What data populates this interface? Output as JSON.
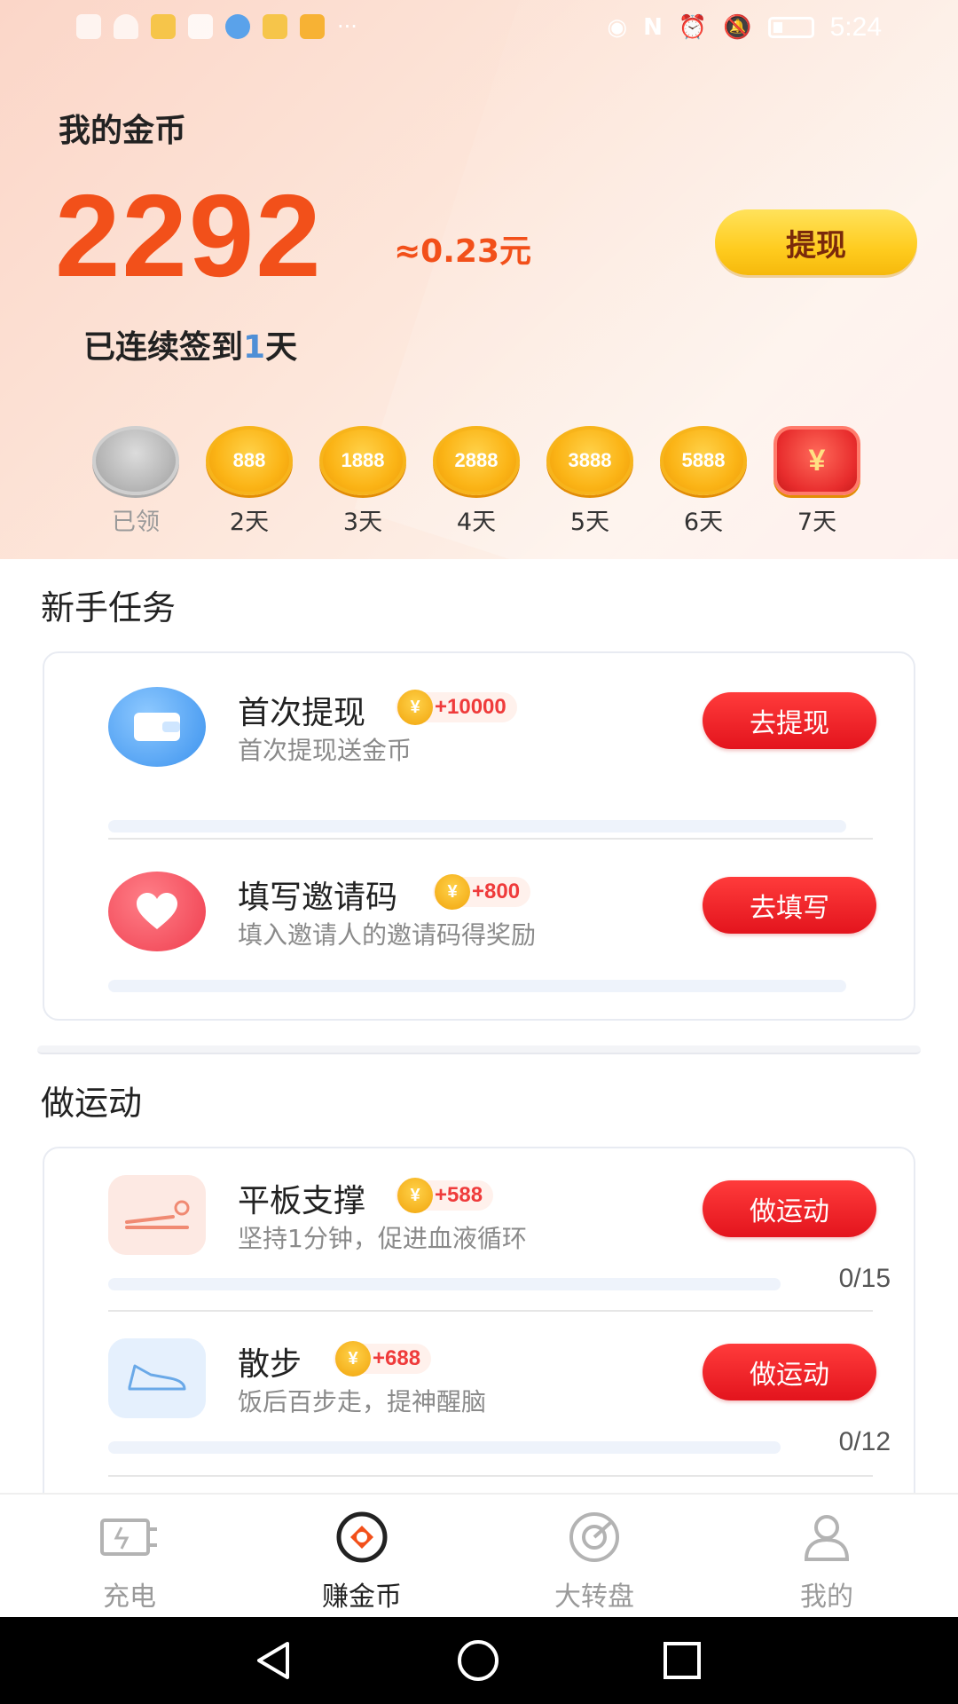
{
  "status_bar": {
    "time": "5:24"
  },
  "header": {
    "coins_title": "我的金币",
    "coins_value": "2292",
    "coins_approx": "≈0.23元",
    "withdraw_label": "提现",
    "checkin_prefix": "已连续签到",
    "checkin_days": "1",
    "checkin_suffix": "天"
  },
  "streak": [
    {
      "coin": "",
      "label": "已领",
      "claimed": true
    },
    {
      "coin": "888",
      "label": "2天"
    },
    {
      "coin": "1888",
      "label": "3天"
    },
    {
      "coin": "2888",
      "label": "4天"
    },
    {
      "coin": "3888",
      "label": "5天"
    },
    {
      "coin": "5888",
      "label": "6天"
    },
    {
      "coin": "¥",
      "label": "7天"
    }
  ],
  "newbie": {
    "title": "新手任务",
    "tasks": [
      {
        "name": "首次提现",
        "reward": "+10000",
        "desc": "首次提现送金币",
        "button": "去提现"
      },
      {
        "name": "填写邀请码",
        "reward": "+800",
        "desc": "填入邀请人的邀请码得奖励",
        "button": "去填写"
      }
    ]
  },
  "exercise": {
    "title": "做运动",
    "tasks": [
      {
        "name": "平板支撑",
        "reward": "+588",
        "desc": "坚持1分钟，促进血液循环",
        "button": "做运动",
        "progress": "0/15"
      },
      {
        "name": "散步",
        "reward": "+688",
        "desc": "饭后百步走，提神醒脑",
        "button": "做运动",
        "progress": "0/12"
      }
    ]
  },
  "coin_glyph": "¥",
  "bottom_nav": [
    {
      "label": "充电",
      "icon": "charge-icon"
    },
    {
      "label": "赚金币",
      "icon": "earn-coin-icon",
      "active": true
    },
    {
      "label": "大转盘",
      "icon": "wheel-icon"
    },
    {
      "label": "我的",
      "icon": "user-icon"
    }
  ],
  "colors": {
    "accent": "#f2501a",
    "button_red": "#e3141d",
    "gold": "#ffcc1f",
    "progress_blue": "#4f8fd6"
  }
}
